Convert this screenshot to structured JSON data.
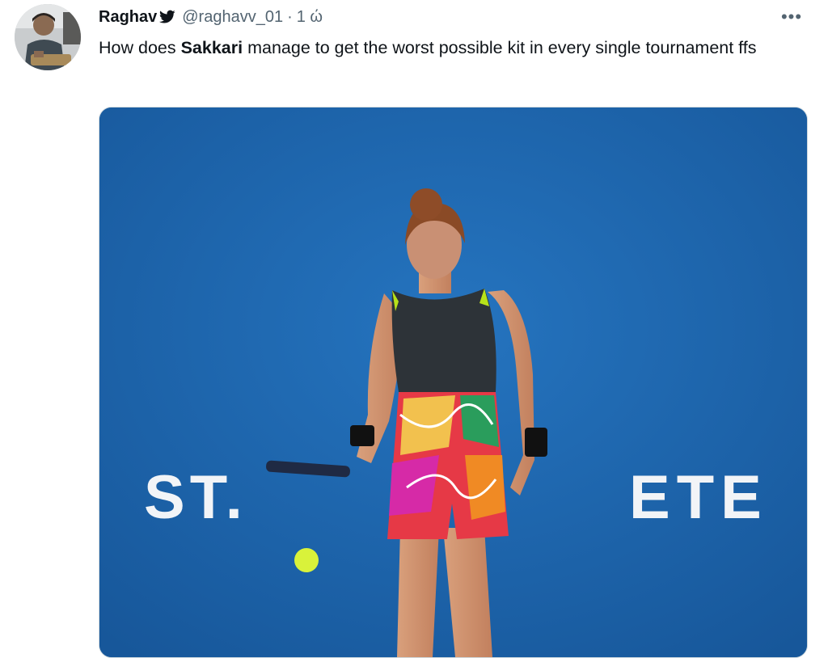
{
  "tweet": {
    "display_name": "Raghav",
    "handle": "@raghavv_01",
    "separator": "·",
    "time": "1 ώ",
    "more_label": "•••",
    "text_before": "How does ",
    "text_bold": "Sakkari",
    "text_after": " manage to get the worst possible kit in every single tournament ffs"
  },
  "media": {
    "court_text_left": "ST.",
    "court_text_right": "ETE",
    "court_color": "#1c5fa4"
  },
  "icons": {
    "avatar": "avatar-photo",
    "bird": "bird-icon",
    "more": "more-icon"
  }
}
